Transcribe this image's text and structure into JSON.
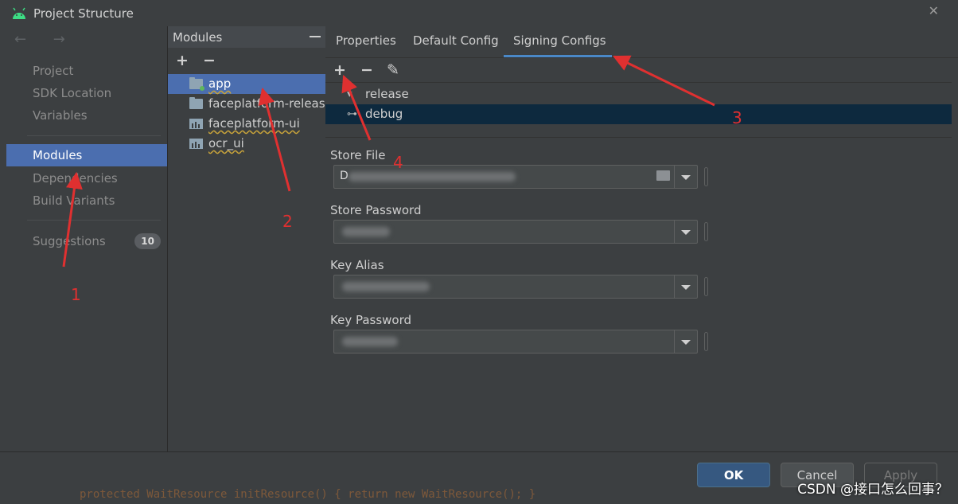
{
  "window": {
    "title": "Project Structure",
    "close_glyph": "✕"
  },
  "nav": {
    "back_forward": "← →",
    "items": [
      {
        "label": "Project"
      },
      {
        "label": "SDK Location"
      },
      {
        "label": "Variables"
      },
      {
        "label": "Modules",
        "selected": true
      },
      {
        "label": "Dependencies"
      },
      {
        "label": "Build Variants"
      }
    ],
    "suggestions": {
      "label": "Suggestions",
      "count": "10"
    }
  },
  "modules": {
    "title": "Modules",
    "add": "+",
    "remove": "−",
    "items": [
      {
        "label": "app",
        "selected": true,
        "icon": "app-module-icon"
      },
      {
        "label": "faceplatform-release",
        "icon": "folder-icon"
      },
      {
        "label": "faceplatform-ui",
        "icon": "library-icon"
      },
      {
        "label": "ocr_ui",
        "icon": "library-icon"
      }
    ]
  },
  "tabs": [
    {
      "label": "Properties"
    },
    {
      "label": "Default Config"
    },
    {
      "label": "Signing Configs",
      "active": true
    }
  ],
  "signing": {
    "add": "+",
    "remove": "−",
    "edit": "✎",
    "configs": [
      {
        "label": "release",
        "icon": "expand-icon"
      },
      {
        "label": "debug",
        "icon": "key-icon",
        "selected": true
      }
    ],
    "fields": {
      "store_file": {
        "label": "Store File",
        "value": "D"
      },
      "store_password": {
        "label": "Store Password"
      },
      "key_alias": {
        "label": "Key Alias"
      },
      "key_password": {
        "label": "Key Password"
      }
    }
  },
  "footer": {
    "ok": "OK",
    "cancel": "Cancel",
    "apply": "Apply"
  },
  "background_code": "protected WaitResource initResource() { return new WaitResource(); }",
  "watermark": "CSDN @接口怎么回事？",
  "annotations": [
    "1",
    "2",
    "3",
    "4"
  ],
  "colors": {
    "selection": "#4b6eaf",
    "tab_underline": "#4a88c7",
    "ok_button": "#365880",
    "annotation": "#e03030"
  }
}
